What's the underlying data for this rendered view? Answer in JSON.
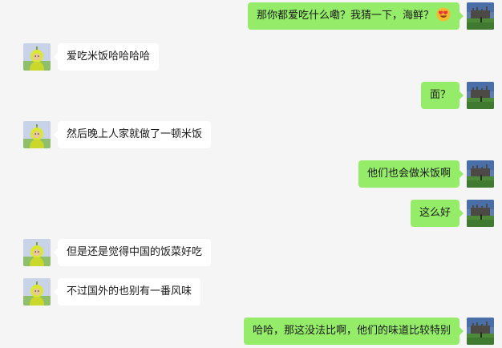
{
  "messages": [
    {
      "side": "right",
      "text": "那你都爱吃什么嘞？我猜一下，海鲜？",
      "emoji": "heart-eyes-emoji-icon"
    },
    {
      "side": "left",
      "text": "爱吃米饭哈哈哈哈"
    },
    {
      "side": "right",
      "text": "面？"
    },
    {
      "side": "left",
      "text": "然后晚上人家就做了一顿米饭"
    },
    {
      "side": "right",
      "text": "他们也会做米饭啊"
    },
    {
      "side": "right",
      "text": "这么好"
    },
    {
      "side": "left",
      "text": "但是还是觉得中国的饭菜好吃"
    },
    {
      "side": "left",
      "text": "不过国外的也别有一番风味"
    },
    {
      "side": "right",
      "text": "哈哈，那这没法比啊，他们的味道比较特别"
    }
  ],
  "colors": {
    "background": "#f5f5f5",
    "bubble_self": "#95ec69",
    "bubble_other": "#ffffff"
  },
  "avatars": {
    "self": "castle-landscape-avatar",
    "other": "teletubby-avatar"
  }
}
